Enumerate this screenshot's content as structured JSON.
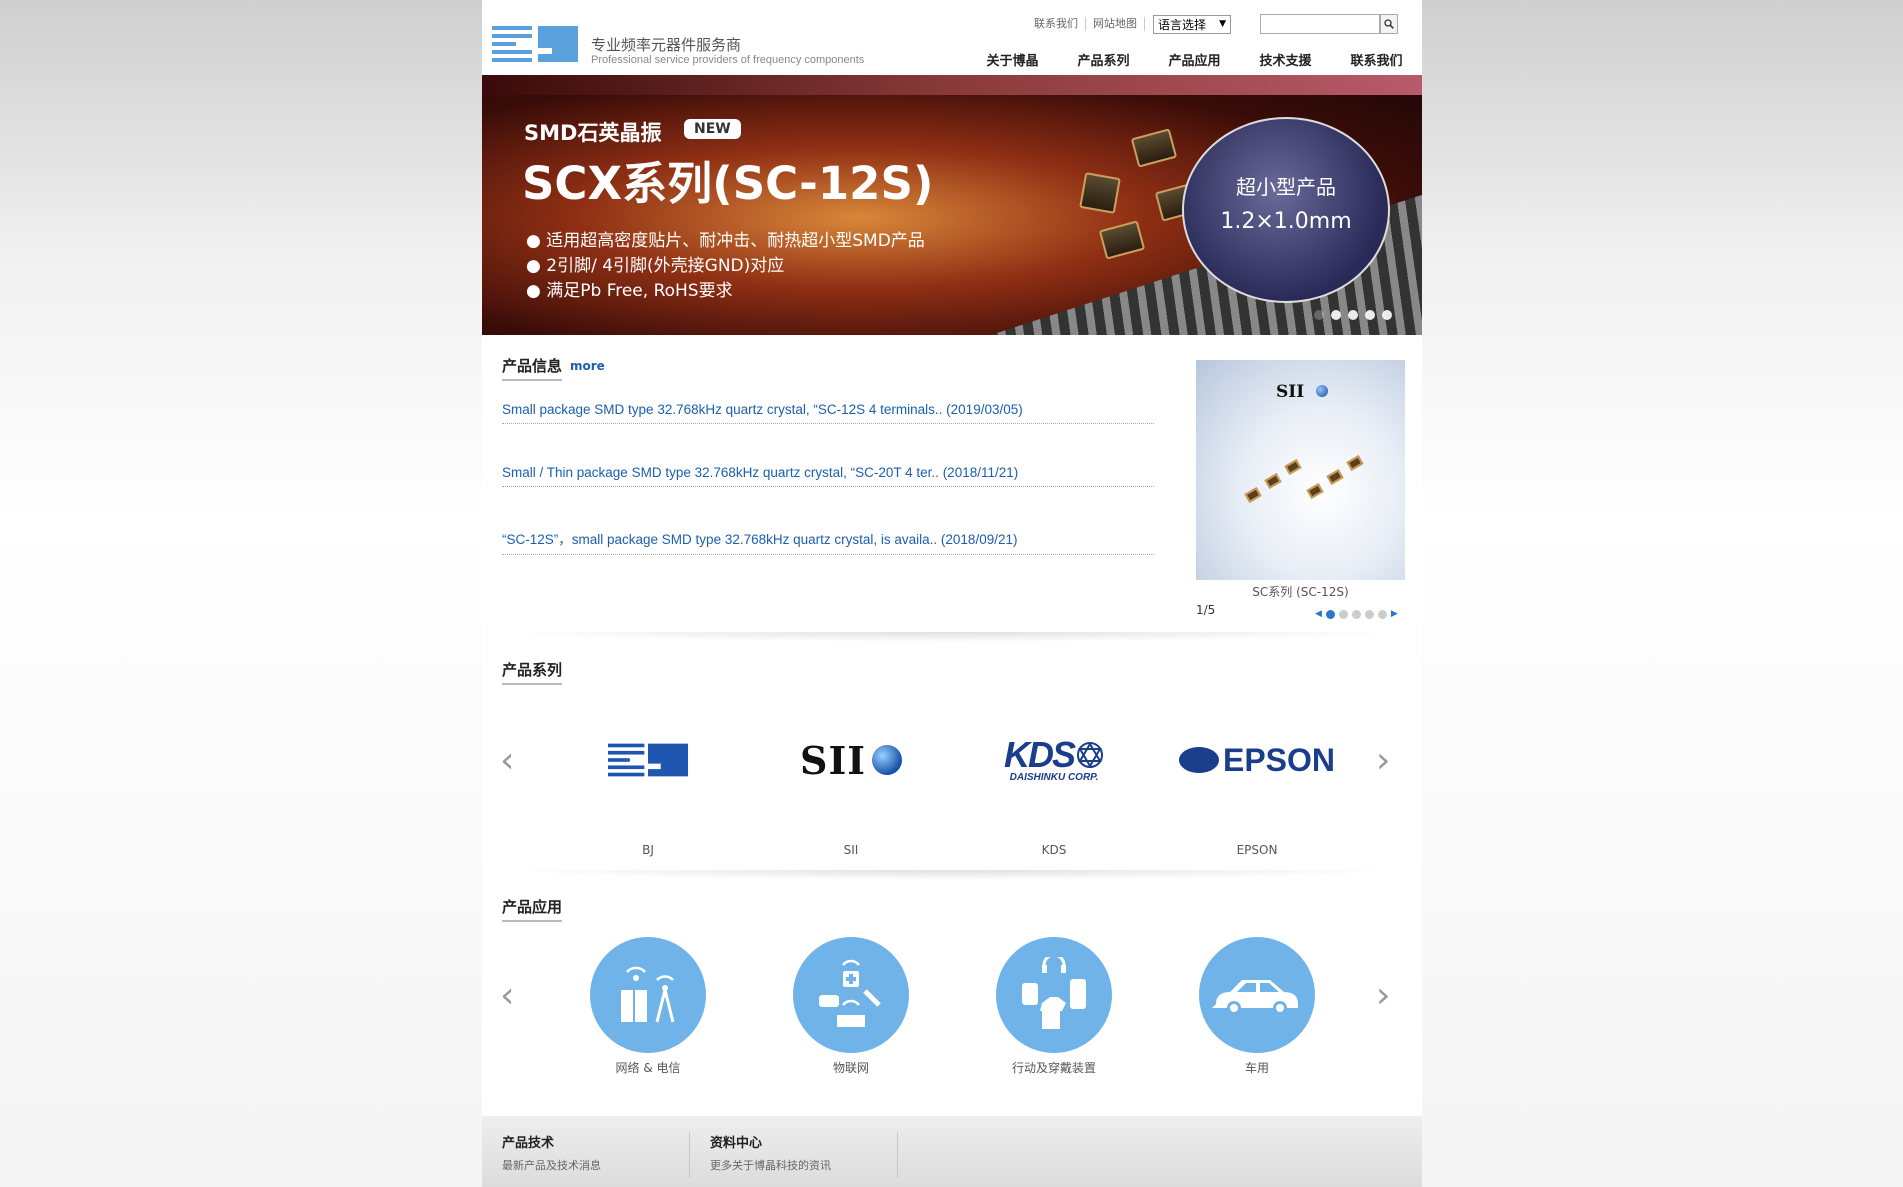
{
  "header": {
    "brand_cn": "专业频率元器件服务商",
    "brand_en": "Professional service providers of frequency components",
    "top_links": [
      "联系我们",
      "网站地图"
    ],
    "language_select": "语言选择",
    "search_placeholder": "",
    "nav": [
      "关于博晶",
      "产品系列",
      "产品应用",
      "技术支援",
      "联系我们"
    ]
  },
  "banner": {
    "subtitle": "SMD石英晶振",
    "badge": "NEW",
    "title": "SCX系列(SC-12S)",
    "bullets": [
      "适用超高密度贴片、耐冲击、耐热超小型SMD产品",
      "2引脚/ 4引脚(外壳接GND)对应",
      "满足Pb Free, RoHS要求"
    ],
    "circle_line1": "超小型产品",
    "circle_line2": "1.2×1.0mm",
    "slides": 5,
    "active_slide": 1
  },
  "info": {
    "title": "产品信息",
    "more": "more",
    "news": [
      "Small package SMD type 32.768kHz quartz crystal, “SC-12S 4 terminals.. (2019/03/05)",
      "Small / Thin package SMD type 32.768kHz quartz crystal, “SC-20T 4 ter.. (2018/11/21)",
      "“SC-12S”，small package SMD type 32.768kHz quartz crystal, is availa.. (2018/09/21)"
    ],
    "feature_logo": "SII",
    "feature_caption": "SC系列 (SC-12S)",
    "pager": "1/5",
    "pager_dots": 5
  },
  "series": {
    "title": "产品系列",
    "brands": [
      "BJ",
      "SII",
      "KDS",
      "EPSON"
    ],
    "sii_logo": "SII",
    "kds_logo": "KDS",
    "kds_sub": "DAISHINKU CORP.",
    "epson_logo": "EPSON"
  },
  "applications": {
    "title": "产品应用",
    "items": [
      "网络 & 电信",
      "物联网",
      "行动及穿戴装置",
      "车用"
    ]
  },
  "footer": {
    "cols": [
      {
        "title": "产品技术",
        "sub": "最新产品及技术消息"
      },
      {
        "title": "资料中心",
        "sub": "更多关于博晶科技的资讯"
      }
    ]
  },
  "colors": {
    "link": "#1b5fae",
    "app_circle": "#6fb3e8",
    "brand_blue": "#1a3e8c"
  }
}
